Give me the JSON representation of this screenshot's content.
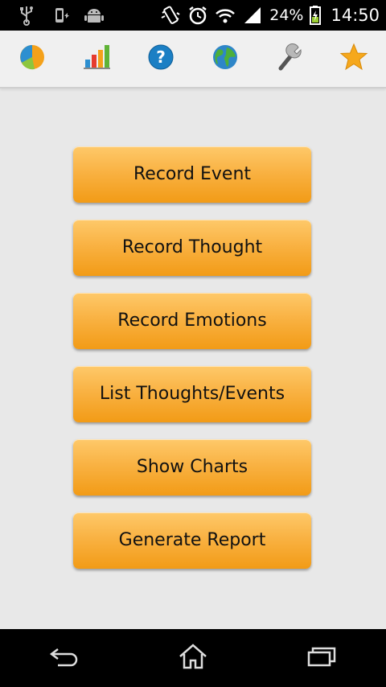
{
  "status_bar": {
    "battery_percent": "24%",
    "time": "14:50",
    "icons": [
      "usb-icon",
      "phone-charge-icon",
      "android-icon",
      "vibrate-icon",
      "alarm-icon",
      "wifi-icon",
      "signal-icon",
      "battery-icon"
    ]
  },
  "toolbar": {
    "icons": [
      "pie-chart-icon",
      "bar-chart-icon",
      "help-icon",
      "globe-icon",
      "wrench-icon",
      "star-icon"
    ]
  },
  "menu": {
    "record_event": "Record Event",
    "record_thought": "Record Thought",
    "record_emotions": "Record Emotions",
    "list_thoughts_events": "List Thoughts/Events",
    "show_charts": "Show Charts",
    "generate_report": "Generate Report"
  },
  "nav_bar": {
    "icons": [
      "back-icon",
      "home-icon",
      "recent-apps-icon"
    ]
  },
  "colors": {
    "button_top": "#fec96a",
    "button_bottom": "#f29b16",
    "background": "#e8e8e8",
    "toolbar": "#f0f0f0"
  }
}
